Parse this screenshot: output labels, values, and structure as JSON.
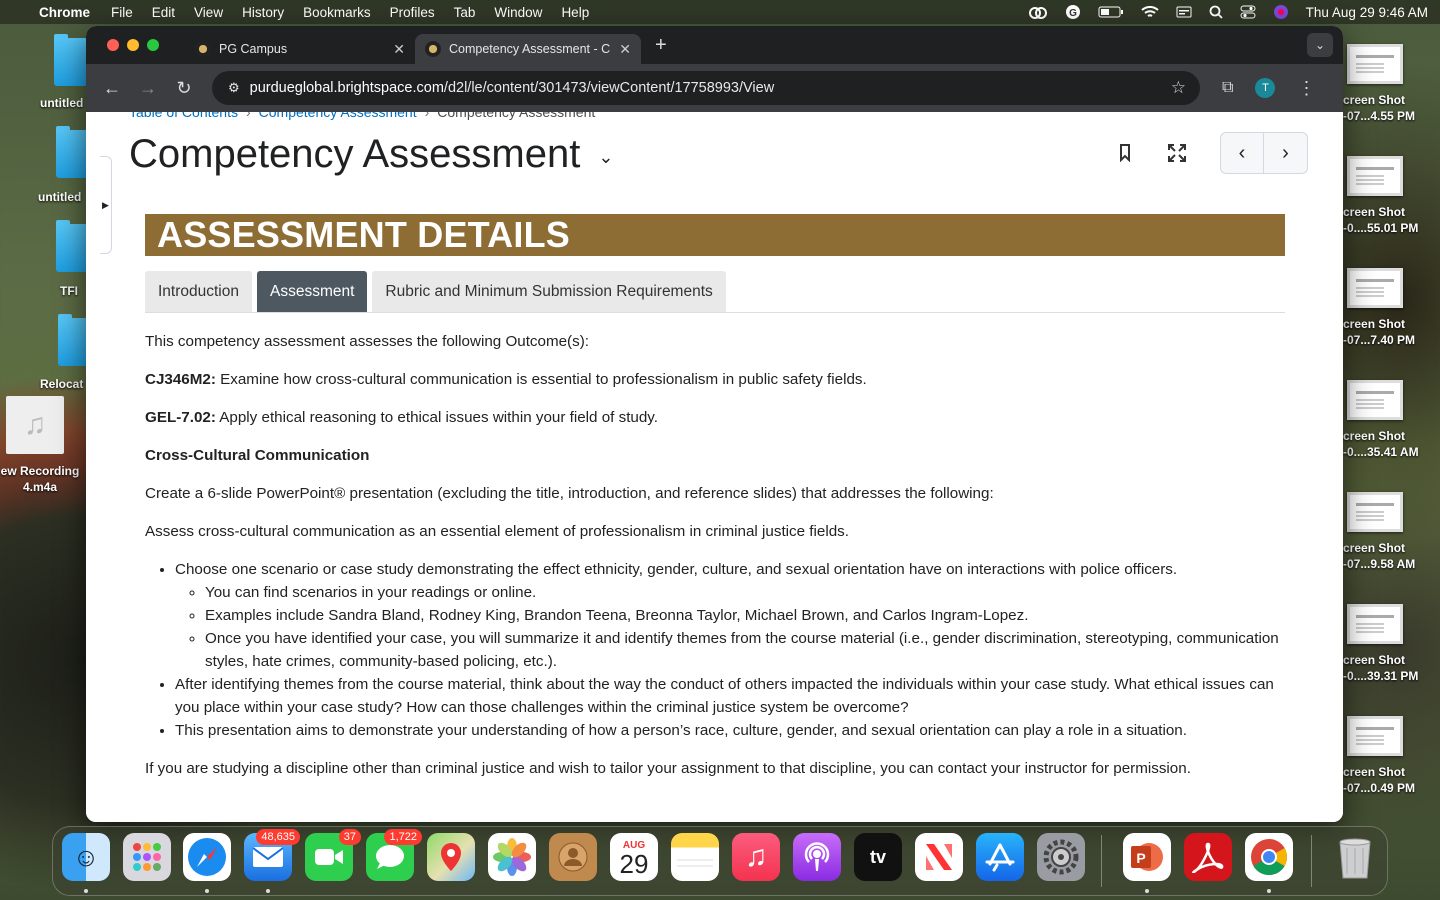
{
  "menubar": {
    "apple": "",
    "app_name": "Chrome",
    "menus": [
      "File",
      "Edit",
      "View",
      "History",
      "Bookmarks",
      "Profiles",
      "Tab",
      "Window",
      "Help"
    ],
    "datetime": "Thu Aug 29  9:46 AM"
  },
  "desktop": {
    "left_items": [
      "untitled",
      "untitled",
      "TFI",
      "Relocat",
      "ew Recording\n4.m4a"
    ],
    "screenshots": [
      "creen Shot\n-07...4.55 PM",
      "creen Shot\n-0....55.01 PM",
      "creen Shot\n-07...7.40 PM",
      "creen Shot\n-0....35.41 AM",
      "creen Shot\n-07...9.58 AM",
      "creen Shot\n-0....39.31 PM",
      "creen Shot\n-07...0.49 PM"
    ]
  },
  "browser": {
    "tabs": [
      {
        "title": "PG Campus",
        "active": false
      },
      {
        "title": "Competency Assessment - C",
        "active": true
      }
    ],
    "new_tab": "+",
    "url_host": "purdueglobal.brightspace.com",
    "url_path": "/d2l/le/content/301473/viewContent/17758993/View",
    "profile_initial": "T"
  },
  "page": {
    "breadcrumb": [
      "Table of Contents",
      "Competency Assessment",
      "Competency Assessment"
    ],
    "title": "Competency Assessment",
    "banner": "ASSESSMENT DETAILS",
    "content_tabs": [
      {
        "label": "Introduction",
        "active": false
      },
      {
        "label": "Assessment",
        "active": true
      },
      {
        "label": "Rubric and Minimum Submission Requirements",
        "active": false
      }
    ],
    "intro": "This competency assessment assesses the following Outcome(s):",
    "outcomes": [
      {
        "code": "CJ346M2:",
        "text": " Examine how cross-cultural communication is essential to professionalism in public safety fields."
      },
      {
        "code": "GEL-7.02:",
        "text": " Apply ethical reasoning to ethical issues within your field of study."
      }
    ],
    "section_heading": "Cross-Cultural Communication",
    "para1": "Create a 6-slide PowerPoint® presentation (excluding the title, introduction, and reference slides) that addresses the following:",
    "para2": "Assess cross-cultural communication as an essential element of professionalism in criminal justice fields.",
    "bullet1": "Choose one scenario or case study demonstrating the effect ethnicity, gender, culture, and sexual orientation have on interactions with police officers.",
    "sub_bullets": [
      "You can find scenarios in your readings or online.",
      "Examples include Sandra Bland, Rodney King, Brandon Teena, Breonna Taylor, Michael Brown, and Carlos Ingram-Lopez.",
      "Once you have identified your case, you will summarize it and identify themes from the course material (i.e., gender discrimination, stereotyping, communication styles, hate crimes, community-based policing, etc.)."
    ],
    "bullet2": "After identifying themes from the course material, think about the way the conduct of others impacted the individuals within your case study. What ethical issues can you place within your case study? How can those challenges within the criminal justice system be overcome?",
    "bullet3": "This presentation aims to demonstrate your understanding of how a person’s race, culture, gender, and sexual orientation can play a role in a situation.",
    "para3": "If you are studying a discipline other than criminal justice and wish to tailor your assignment to that discipline, you can contact your instructor for permission."
  },
  "dock": {
    "mail_badge": "48,635",
    "facetime_badge": "37",
    "messages_badge": "1,722",
    "calendar_month": "AUG",
    "calendar_day": "29",
    "tv_label": "tv",
    "colors": {
      "banner": "#8e6d35",
      "active_tab": "#4e5861",
      "link": "#006fbf"
    }
  }
}
